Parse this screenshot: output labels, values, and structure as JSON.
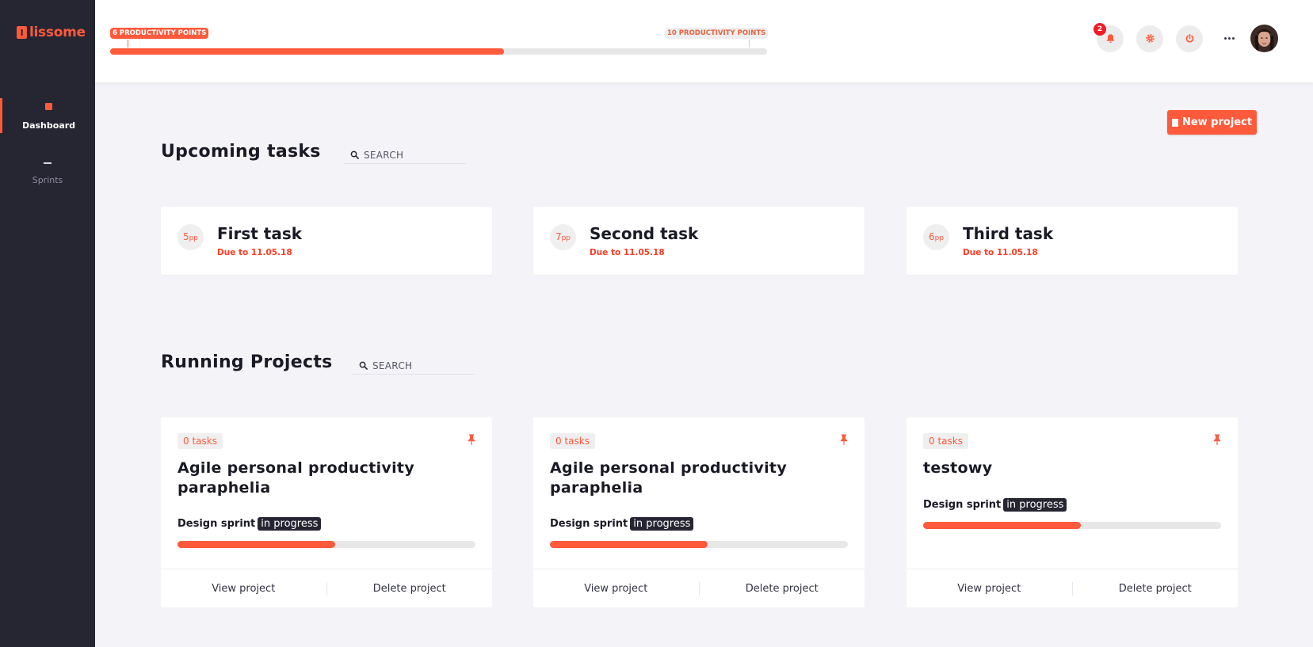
{
  "app": {
    "brand": "lissome",
    "brand_mark": "l",
    "accent": "#ff5a3c",
    "sidebar_bg": "#262633"
  },
  "sidebar": {
    "items": [
      {
        "label": "Dashboard",
        "active": true
      },
      {
        "label": "Sprints",
        "active": false
      }
    ]
  },
  "header": {
    "current_points_label": "6 PRODUCTIVITY POINTS",
    "goal_points_label": "10 PRODUCTIVITY POINTS",
    "progress_fraction": 0.6,
    "notification_count": "2",
    "icons": [
      "bell-icon",
      "gear-icon",
      "power-icon",
      "more-icon"
    ]
  },
  "new_project_label": "New project",
  "upcoming": {
    "title": "Upcoming tasks",
    "search_placeholder": "SEARCH",
    "tasks": [
      {
        "points": "5",
        "unit": "pp",
        "name": "First task",
        "due": "Due to 11.05.18"
      },
      {
        "points": "7",
        "unit": "pp",
        "name": "Second task",
        "due": "Due to 11.05.18"
      },
      {
        "points": "6",
        "unit": "pp",
        "name": "Third task",
        "due": "Due to 11.05.18"
      }
    ]
  },
  "projects": {
    "title": "Running Projects",
    "search_placeholder": "SEARCH",
    "view_label": "View project",
    "delete_label": "Delete project",
    "items": [
      {
        "tasks": "0 tasks",
        "name": "Agile personal productivity paraphelia",
        "sprint": "Design sprint",
        "status": "in progress",
        "progress": 0.53
      },
      {
        "tasks": "0 tasks",
        "name": "Agile personal productivity paraphelia",
        "sprint": "Design sprint",
        "status": "in progress",
        "progress": 0.53
      },
      {
        "tasks": "0 tasks",
        "name": "testowy",
        "sprint": "Design sprint",
        "status": "in progress",
        "progress": 0.53
      }
    ]
  }
}
